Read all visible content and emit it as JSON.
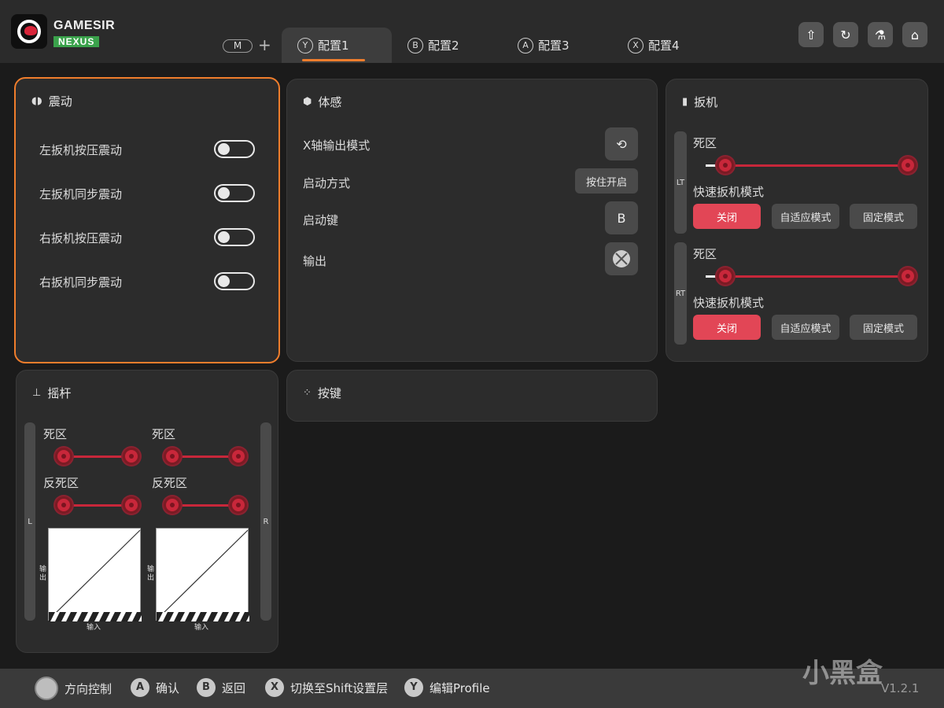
{
  "header": {
    "brand_top": "GAMESIR",
    "brand_bottom": "NEXUS",
    "m_label": "M",
    "plus": "+",
    "tabs": [
      {
        "key": "Y",
        "label": "配置1",
        "active": true
      },
      {
        "key": "B",
        "label": "配置2",
        "active": false
      },
      {
        "key": "A",
        "label": "配置3",
        "active": false
      },
      {
        "key": "X",
        "label": "配置4",
        "active": false
      }
    ],
    "actions": [
      "upload-icon",
      "refresh-icon",
      "flask-icon",
      "home-icon"
    ],
    "accent": "#ef7d2c"
  },
  "vibration": {
    "title": "震动",
    "items": [
      {
        "label": "左扳机按压震动",
        "on": false
      },
      {
        "label": "左扳机同步震动",
        "on": false
      },
      {
        "label": "右扳机按压震动",
        "on": false
      },
      {
        "label": "右扳机同步震动",
        "on": false
      }
    ]
  },
  "motion": {
    "title": "体感",
    "x_axis_label": "X轴输出模式",
    "start_mode_label": "启动方式",
    "start_mode_value": "按住开启",
    "start_key_label": "启动键",
    "start_key_value": "B",
    "output_label": "输出"
  },
  "trigger": {
    "title": "扳机",
    "lt": {
      "tag": "LT",
      "deadzone_label": "死区",
      "fast_label": "快速扳机模式",
      "options": [
        "关闭",
        "自适应模式",
        "固定模式"
      ],
      "selected": "关闭"
    },
    "rt": {
      "tag": "RT",
      "deadzone_label": "死区",
      "fast_label": "快速扳机模式",
      "options": [
        "关闭",
        "自适应模式",
        "固定模式"
      ],
      "selected": "关闭"
    },
    "active_color": "#e24656"
  },
  "stick": {
    "title": "摇杆",
    "left_tag": "L",
    "right_tag": "R",
    "left": {
      "deadzone_label": "死区",
      "anti_label": "反死区",
      "out_label": "输出",
      "in_label": "输入"
    },
    "right": {
      "deadzone_label": "死区",
      "anti_label": "反死区",
      "out_label": "输出",
      "in_label": "输入"
    }
  },
  "buttons_panel": {
    "title": "按键"
  },
  "footer": {
    "items": [
      {
        "key": "",
        "label": "方向控制"
      },
      {
        "key": "A",
        "label": "确认"
      },
      {
        "key": "B",
        "label": "返回"
      },
      {
        "key": "X",
        "label": "切换至Shift设置层"
      },
      {
        "key": "Y",
        "label": "编辑Profile"
      }
    ],
    "watermark": "小黑盒",
    "version": "V1.2.1"
  }
}
